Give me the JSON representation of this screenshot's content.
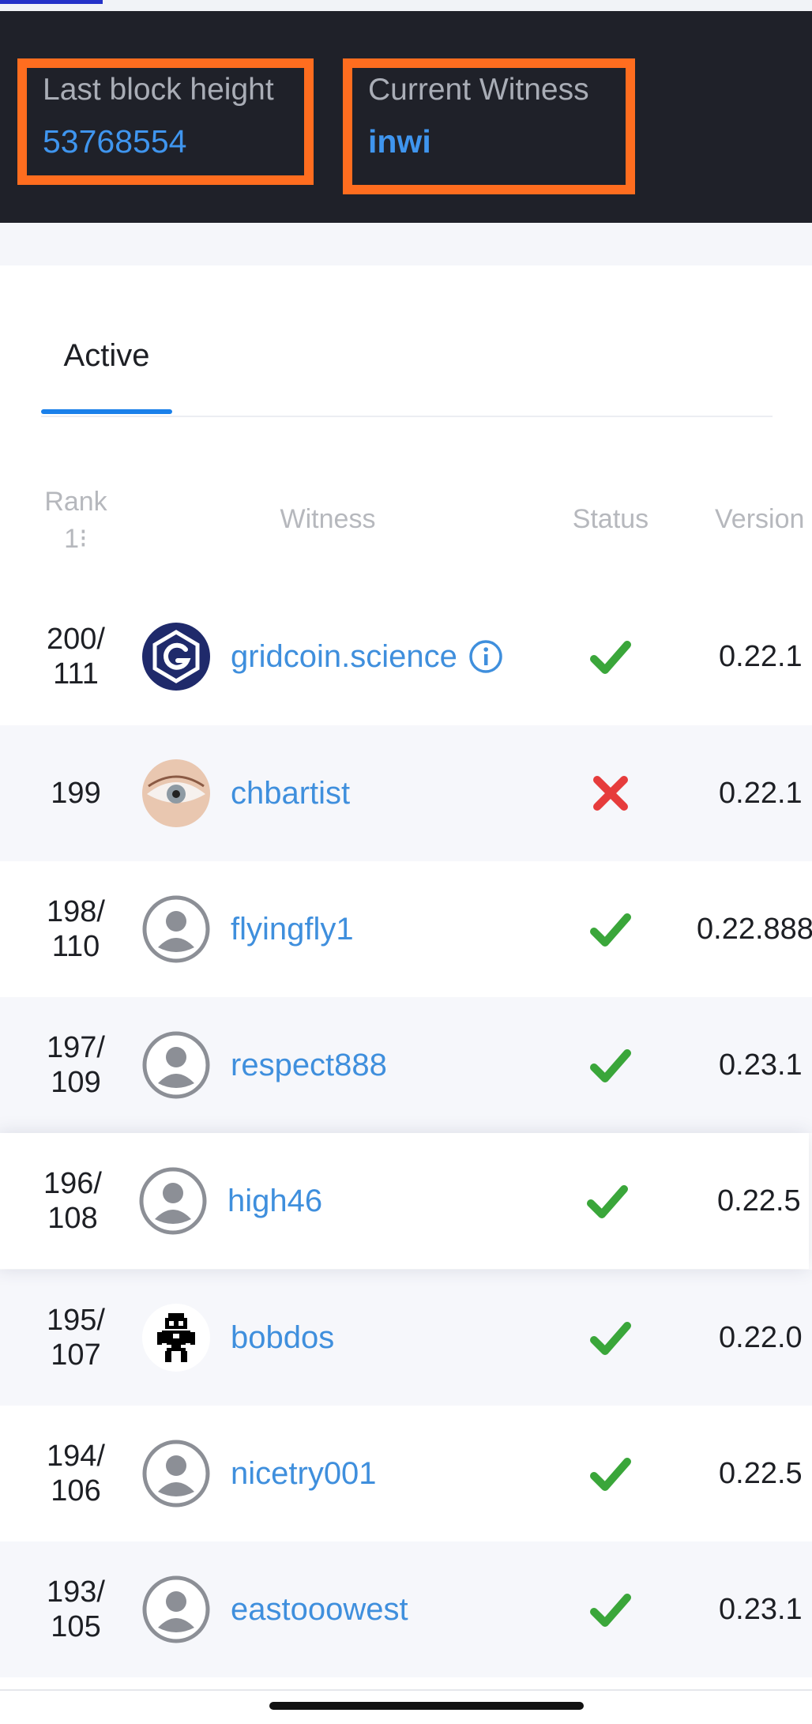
{
  "stats": {
    "last_block_label": "Last block height",
    "last_block_value": "53768554",
    "current_witness_label": "Current Witness",
    "current_witness_value": "inwi"
  },
  "tabs": {
    "active_label": "Active"
  },
  "table": {
    "headers": {
      "rank": "Rank",
      "rank_sort_icon": "1⁝",
      "witness": "Witness",
      "status": "Status",
      "version": "Version"
    },
    "rows": [
      {
        "rank_top": "200/",
        "rank_bottom": "111",
        "name": "gridcoin.science",
        "avatar": "gridcoin-logo-avatar",
        "status": "ok",
        "version": "0.22.1",
        "has_info": true
      },
      {
        "rank_top": "199",
        "rank_bottom": "",
        "name": "chbartist",
        "avatar": "eye-photo-avatar",
        "status": "error",
        "version": "0.22.1",
        "has_info": false
      },
      {
        "rank_top": "198/",
        "rank_bottom": "110",
        "name": "flyingfly1",
        "avatar": "default-user-avatar",
        "status": "ok",
        "version": "0.22.888",
        "has_info": false
      },
      {
        "rank_top": "197/",
        "rank_bottom": "109",
        "name": "respect888",
        "avatar": "default-user-avatar",
        "status": "ok",
        "version": "0.23.1",
        "has_info": false
      },
      {
        "rank_top": "196/",
        "rank_bottom": "108",
        "name": "high46",
        "avatar": "default-user-avatar",
        "status": "ok",
        "version": "0.22.5",
        "has_info": false
      },
      {
        "rank_top": "195/",
        "rank_bottom": "107",
        "name": "bobdos",
        "avatar": "pixel-character-avatar",
        "status": "ok",
        "version": "0.22.0",
        "has_info": false
      },
      {
        "rank_top": "194/",
        "rank_bottom": "106",
        "name": "nicetry001",
        "avatar": "default-user-avatar",
        "status": "ok",
        "version": "0.22.5",
        "has_info": false
      },
      {
        "rank_top": "193/",
        "rank_bottom": "105",
        "name": "eastooowest",
        "avatar": "default-user-avatar",
        "status": "ok",
        "version": "0.23.1",
        "has_info": false
      }
    ]
  },
  "colors": {
    "header_bg": "#1f2129",
    "highlight_border": "#ff6d1f",
    "link_blue": "#3f8fdd",
    "status_ok": "#3aa63a",
    "status_error": "#e63c3c",
    "tab_underline": "#1a80ea"
  }
}
